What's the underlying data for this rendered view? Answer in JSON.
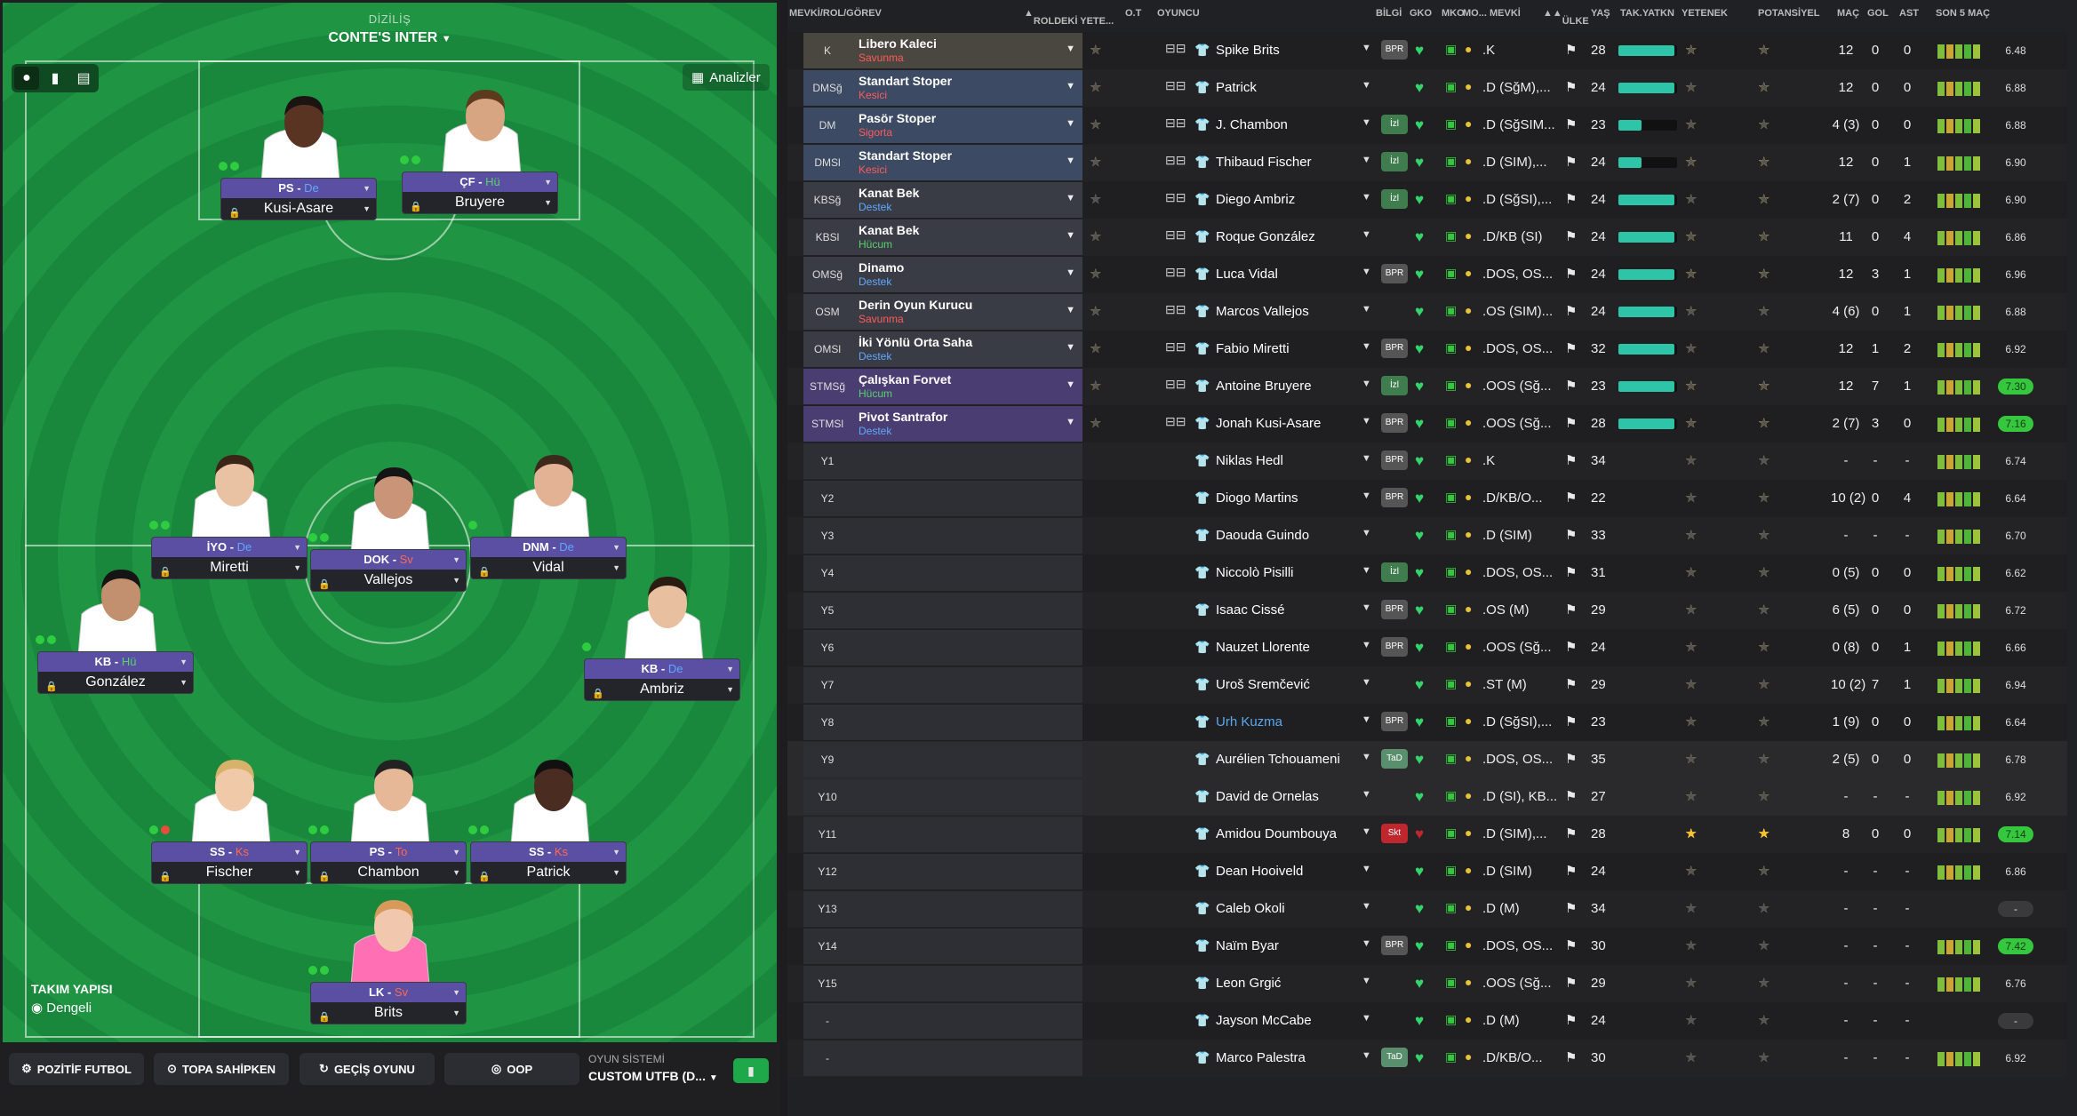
{
  "pitch": {
    "caption_sub": "DİZİLİŞ",
    "caption_name": "CONTE'S INTER",
    "analyze_label": "Analizler",
    "team_structure_label": "TAKIM YAPISI",
    "team_structure_value": "Dengeli",
    "players": [
      {
        "role": "PS",
        "duty": "De",
        "name": "Kusi-Asare"
      },
      {
        "role": "ÇF",
        "duty": "Hü",
        "name": "Bruyere"
      },
      {
        "role": "İYO",
        "duty": "De",
        "name": "Miretti"
      },
      {
        "role": "DOK",
        "duty": "Sv",
        "name": "Vallejos"
      },
      {
        "role": "DNM",
        "duty": "De",
        "name": "Vidal"
      },
      {
        "role": "KB",
        "duty": "Hü",
        "name": "González"
      },
      {
        "role": "KB",
        "duty": "De",
        "name": "Ambriz"
      },
      {
        "role": "SS",
        "duty": "Ks",
        "name": "Fischer"
      },
      {
        "role": "PS",
        "duty": "To",
        "name": "Chambon"
      },
      {
        "role": "SS",
        "duty": "Ks",
        "name": "Patrick"
      },
      {
        "role": "LK",
        "duty": "Sv",
        "name": "Brits"
      }
    ]
  },
  "bottom_bar": {
    "btn1": "POZİTİF FUTBOL",
    "btn2": "TOPA SAHİPKEN",
    "btn3": "GEÇİŞ OYUNU",
    "btn4": "OOP",
    "system_label": "OYUN SİSTEMİ",
    "system_value": "CUSTOM UTFB (D..."
  },
  "table": {
    "headers": {
      "pos": "MEVKİ/ROL/GÖREV",
      "role_ability": "ROLDEKİ YETE...",
      "ot": "O.T",
      "player": "OYUNCU",
      "info": "BİLGİ",
      "gko": "GKO",
      "mko": "MKO",
      "mo": "MO...",
      "mevki": "MEVKİ",
      "country": "ÜLKE",
      "age": "YAŞ",
      "fit": "TAK.YATKN",
      "ability": "YETENEK",
      "potential": "POTANSİYEL",
      "apps": "MAÇ",
      "goals": "GOL",
      "assists": "AST",
      "last5": "SON 5 MAÇ"
    },
    "rows": [
      {
        "pos": "K",
        "role": "Libero Kaleci",
        "duty": "Savunma",
        "rstars": "3",
        "name": "Spike Brits",
        "badge": "BPR",
        "mpos": ".K",
        "age": "28",
        "fit": 95,
        "ab": "3.5",
        "pot": "3.5",
        "apps": "12",
        "g": "0",
        "a": "0",
        "rating": "6.48"
      },
      {
        "pos": "DMSğ",
        "role": "Standart Stoper",
        "duty": "Kesici",
        "rstars": "3",
        "name": "Patrick",
        "badge": "",
        "mpos": ".D (SğM),...",
        "age": "24",
        "fit": 95,
        "ab": "3",
        "pot": "3.5",
        "apps": "12",
        "g": "0",
        "a": "0",
        "rating": "6.88"
      },
      {
        "pos": "DM",
        "role": "Pasör Stoper",
        "duty": "Sigorta",
        "rstars": "2.5",
        "name": "J. Chambon",
        "badge": "İzl",
        "mpos": ".D (SğSIM...",
        "age": "23",
        "fit": 40,
        "ab": "3",
        "pot": "3",
        "apps": "4 (3)",
        "g": "0",
        "a": "0",
        "rating": "6.88"
      },
      {
        "pos": "DMSl",
        "role": "Standart Stoper",
        "duty": "Kesici",
        "rstars": "3",
        "name": "Thibaud Fischer",
        "badge": "İzl",
        "mpos": ".D (SIM),...",
        "age": "24",
        "fit": 40,
        "ab": "3.5",
        "pot": "4",
        "apps": "12",
        "g": "0",
        "a": "1",
        "rating": "6.90"
      },
      {
        "pos": "KBSğ",
        "role": "Kanat Bek",
        "duty": "Destek",
        "rstars": "2",
        "name": "Diego Ambriz",
        "badge": "İzl",
        "mpos": ".D (SğSI),...",
        "age": "24",
        "fit": 95,
        "ab": "2.5",
        "pot": "3.5",
        "apps": "2 (7)",
        "g": "0",
        "a": "2",
        "rating": "6.90"
      },
      {
        "pos": "KBSl",
        "role": "Kanat Bek",
        "duty": "Hücum",
        "rstars": "3",
        "name": "Roque González",
        "badge": "",
        "mpos": ".D/KB (SI)",
        "age": "24",
        "fit": 95,
        "ab": "3.5",
        "pot": "3.5",
        "apps": "11",
        "g": "0",
        "a": "4",
        "rating": "6.86"
      },
      {
        "pos": "OMSğ",
        "role": "Dinamo",
        "duty": "Destek",
        "rstars": "2.5",
        "name": "Luca Vidal",
        "badge": "BPR",
        "mpos": ".DOS, OS...",
        "age": "24",
        "fit": 95,
        "ab": "3.5",
        "pot": "4",
        "apps": "12",
        "g": "3",
        "a": "1",
        "rating": "6.96"
      },
      {
        "pos": "OSM",
        "role": "Derin Oyun Kurucu",
        "duty": "Savunma",
        "rstars": "3",
        "name": "Marcos Vallejos",
        "badge": "",
        "mpos": ".OS (SIM)...",
        "age": "24",
        "fit": 95,
        "ab": "3",
        "pot": "3",
        "apps": "4 (6)",
        "g": "0",
        "a": "1",
        "rating": "6.88"
      },
      {
        "pos": "OMSl",
        "role": "İki Yönlü Orta Saha",
        "duty": "Destek",
        "rstars": "3",
        "name": "Fabio Miretti",
        "badge": "BPR",
        "mpos": ".DOS, OS...",
        "age": "32",
        "fit": 95,
        "ab": "3",
        "pot": "3",
        "apps": "12",
        "g": "1",
        "a": "2",
        "rating": "6.92"
      },
      {
        "pos": "STMSğ",
        "role": "Çalışkan Forvet",
        "duty": "Hücum",
        "rstars": "3",
        "name": "Antoine Bruyere",
        "badge": "İzl",
        "mpos": ".OOS (Sğ...",
        "age": "23",
        "fit": 95,
        "ab": "3.5",
        "pot": "4",
        "apps": "12",
        "g": "7",
        "a": "1",
        "rating": "7.30"
      },
      {
        "pos": "STMSl",
        "role": "Pivot Santrafor",
        "duty": "Destek",
        "rstars": "2.5",
        "name": "Jonah Kusi-Asare",
        "badge": "BPR",
        "mpos": ".OOS (Sğ...",
        "age": "28",
        "fit": 95,
        "ab": "3.5",
        "pot": "3.5",
        "apps": "2 (7)",
        "g": "3",
        "a": "0",
        "rating": "7.16"
      },
      {
        "pos": "Y1",
        "name": "Niklas Hedl",
        "badge": "BPR",
        "mpos": ".K",
        "age": "34",
        "ab": "2.5",
        "pot": "2.5",
        "apps": "-",
        "g": "-",
        "a": "-",
        "rating": "6.74"
      },
      {
        "pos": "Y2",
        "name": "Diogo Martins",
        "badge": "BPR",
        "mpos": ".D/KB/O...",
        "age": "22",
        "ab": "2.5",
        "pot": "3",
        "apps": "10 (2)",
        "g": "0",
        "a": "4",
        "rating": "6.64"
      },
      {
        "pos": "Y3",
        "name": "Daouda Guindo",
        "badge": "",
        "mpos": ".D (SIM)",
        "age": "33",
        "ab": "2.5",
        "pot": "2.5",
        "apps": "-",
        "g": "-",
        "a": "-",
        "rating": "6.70"
      },
      {
        "pos": "Y4",
        "name": "Niccolò Pisilli",
        "badge": "İzl",
        "mpos": ".DOS, OS...",
        "age": "31",
        "ab": "3",
        "pot": "3",
        "apps": "0 (5)",
        "g": "0",
        "a": "0",
        "rating": "6.62"
      },
      {
        "pos": "Y5",
        "name": "Isaac Cissé",
        "badge": "BPR",
        "mpos": ".OS (M)",
        "age": "29",
        "ab": "3",
        "pot": "3",
        "apps": "6 (5)",
        "g": "0",
        "a": "0",
        "rating": "6.72"
      },
      {
        "pos": "Y6",
        "name": "Nauzet Llorente",
        "badge": "BPR",
        "mpos": ".OOS (Sğ...",
        "age": "24",
        "ab": "2.5",
        "pot": "3",
        "apps": "0 (8)",
        "g": "0",
        "a": "1",
        "rating": "6.66"
      },
      {
        "pos": "Y7",
        "name": "Uroš Sremčević",
        "badge": "",
        "mpos": ".ST (M)",
        "age": "29",
        "ab": "3",
        "pot": "3",
        "apps": "10 (2)",
        "g": "7",
        "a": "1",
        "rating": "6.94"
      },
      {
        "pos": "Y8",
        "name": "Urh Kuzma",
        "badge": "BPR",
        "mpos": ".D (SğSI),...",
        "age": "23",
        "ab": "2.5",
        "pot": "3",
        "apps": "1 (9)",
        "g": "0",
        "a": "0",
        "rating": "6.64",
        "link": true
      },
      {
        "pos": "Y9",
        "name": "Aurélien Tchouameni",
        "badge": "TaD",
        "mpos": ".DOS, OS...",
        "age": "35",
        "ab": "2.5",
        "pot": "2.5",
        "apps": "2 (5)",
        "g": "0",
        "a": "0",
        "rating": "6.78"
      },
      {
        "pos": "Y10",
        "name": "David de Ornelas",
        "badge": "",
        "mpos": ".D (SI), KB...",
        "age": "27",
        "ab": "2.5",
        "pot": "2.5",
        "apps": "-",
        "g": "-",
        "a": "-",
        "rating": "6.92"
      },
      {
        "pos": "Y11",
        "name": "Amidou Doumbouya",
        "badge": "Skt",
        "mpos": ".D (SIM),...",
        "age": "28",
        "ab": "4.5",
        "pot": "4.5",
        "apps": "8",
        "g": "0",
        "a": "0",
        "rating": "7.14"
      },
      {
        "pos": "Y12",
        "name": "Dean Hooiveld",
        "badge": "",
        "mpos": ".D (SIM)",
        "age": "24",
        "ab": "2.5",
        "pot": "3",
        "apps": "-",
        "g": "-",
        "a": "-",
        "rating": "6.86"
      },
      {
        "pos": "Y13",
        "name": "Caleb Okoli",
        "badge": "",
        "mpos": ".D (M)",
        "age": "34",
        "ab": "2",
        "pot": "2",
        "apps": "-",
        "g": "-",
        "a": "-",
        "rating": "-"
      },
      {
        "pos": "Y14",
        "name": "Naïm Byar",
        "badge": "BPR",
        "mpos": ".DOS, OS...",
        "age": "30",
        "ab": "2",
        "pot": "2",
        "apps": "-",
        "g": "-",
        "a": "-",
        "rating": "7.42"
      },
      {
        "pos": "Y15",
        "name": "Leon Grgić",
        "badge": "",
        "mpos": ".OOS (Sğ...",
        "age": "29",
        "ab": "2",
        "pot": "2",
        "apps": "-",
        "g": "-",
        "a": "-",
        "rating": "6.76"
      },
      {
        "pos": "-",
        "name": "Jayson McCabe",
        "badge": "",
        "mpos": ".D (M)",
        "age": "24",
        "ab": "2",
        "pot": "2",
        "apps": "-",
        "g": "-",
        "a": "-",
        "rating": "-"
      },
      {
        "pos": "-",
        "name": "Marco Palestra",
        "badge": "TaD",
        "mpos": ".D/KB/O...",
        "age": "30",
        "ab": "2",
        "pot": "2",
        "apps": "-",
        "g": "-",
        "a": "-",
        "rating": "6.92"
      }
    ]
  },
  "colors": {
    "pitch": "#1b8d3e",
    "role_def": "#3c4a63",
    "role_mid": "#3a3c45",
    "role_att": "#4a3d72",
    "accent_green": "#35c83f"
  }
}
